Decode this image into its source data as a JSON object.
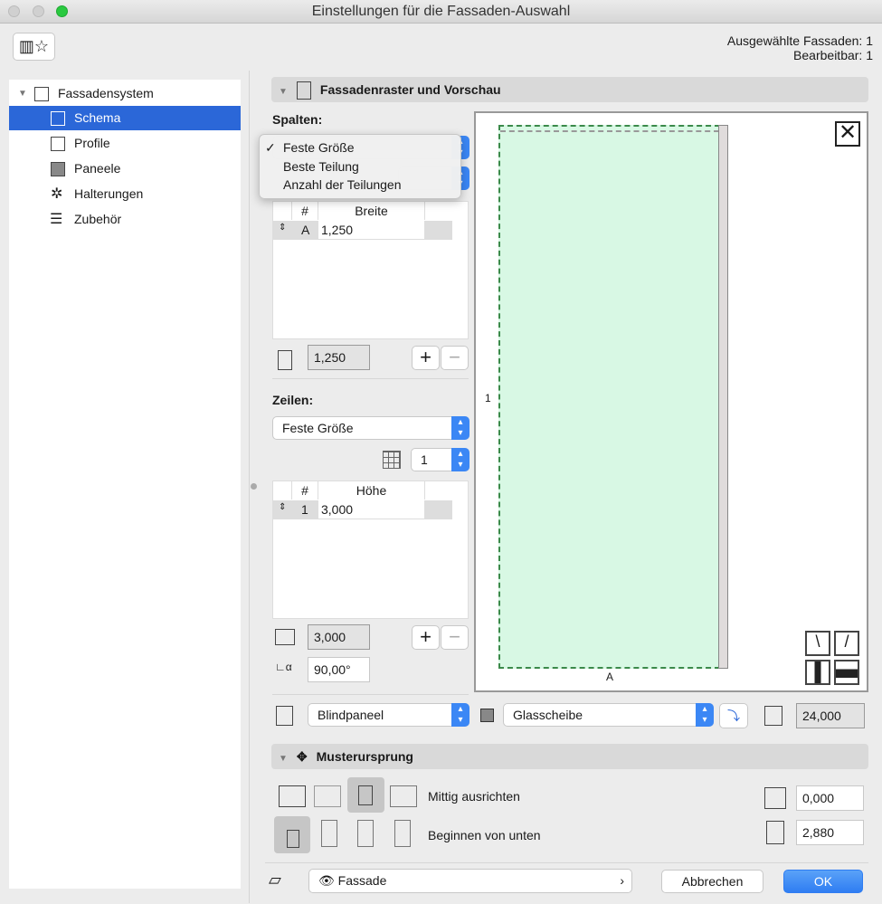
{
  "window": {
    "title": "Einstellungen für die Fassaden-Auswahl"
  },
  "header": {
    "selected": "Ausgewählte Fassaden: 1",
    "editable": "Bearbeitbar: 1"
  },
  "sidebar": {
    "items": [
      {
        "label": "Fassadensystem"
      },
      {
        "label": "Schema"
      },
      {
        "label": "Profile"
      },
      {
        "label": "Paneele"
      },
      {
        "label": "Halterungen"
      },
      {
        "label": "Zubehör"
      }
    ]
  },
  "grid_section": {
    "title": "Fassadenraster und Vorschau",
    "columns_label": "Spalten:",
    "columns_dropdown": {
      "options": [
        "Feste Größe",
        "Beste Teilung",
        "Anzahl der Teilungen"
      ],
      "selected": "Feste Größe",
      "checkmark": "✓"
    },
    "columns_table": {
      "headers": [
        "#",
        "Breite"
      ],
      "rows": [
        {
          "id": "A",
          "value": "1,250"
        }
      ]
    },
    "column_width": "1,250",
    "rows_label": "Zeilen:",
    "rows_mode": "Feste Größe",
    "rows_count": "1",
    "rows_table": {
      "headers": [
        "#",
        "Höhe"
      ],
      "rows": [
        {
          "id": "1",
          "value": "3,000"
        }
      ]
    },
    "row_height": "3,000",
    "angle": "90,00°",
    "preview": {
      "row_label": "1",
      "column_label": "A"
    },
    "panel_frame": "Blindpaneel",
    "panel_glass": "Glasscheibe",
    "total_height": "24,000"
  },
  "pattern_section": {
    "title": "Musterursprung",
    "horizontal_label": "Mittig ausrichten",
    "vertical_label": "Beginnen von unten",
    "offset_x": "0,000",
    "offset_y": "2,880"
  },
  "footer": {
    "layer": "Fassade",
    "cancel": "Abbrechen",
    "ok": "OK"
  }
}
